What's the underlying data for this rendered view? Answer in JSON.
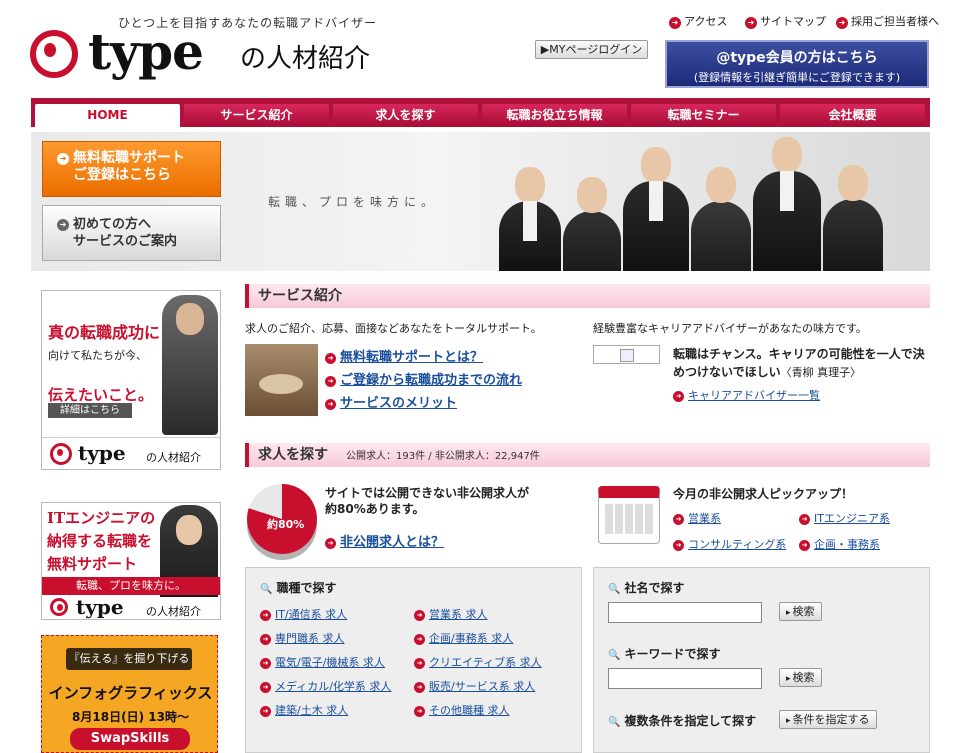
{
  "header": {
    "tagline": "ひとつ上を目指すあなたの転職アドバイザー",
    "logo_type": "type",
    "logo_sub": "の人材紹介",
    "links": [
      "アクセス",
      "サイトマップ",
      "採用ご担当者様へ"
    ],
    "mypage_label": "MYページログイン",
    "member_line1": "@type会員の方はこちら",
    "member_line2": "(登録情報を引継ぎ簡単にご登録できます)"
  },
  "nav": [
    "HOME",
    "サービス紹介",
    "求人を探す",
    "転職お役立ち情報",
    "転職セミナー",
    "会社概要"
  ],
  "hero": {
    "orange_line1": "無料転職サポート",
    "orange_line2": "ご登録はこちら",
    "gray_line1": "初めての方へ",
    "gray_line2": "サービスのご案内",
    "catch": "転職、プロを味方に。"
  },
  "sidebar": {
    "banner1": {
      "t1": "真の転職成功に",
      "t2a": "向けて私たちが今、",
      "t3": "伝えたいこと。",
      "button": "詳細はこちら",
      "logo_type": "type",
      "logo_sub": "の人材紹介"
    },
    "banner2": {
      "l1": "ITエンジニアの",
      "l2": "納得する転職を",
      "l3": "無料サポート",
      "bar": "転職、プロを味方に。",
      "logo_type": "type",
      "logo_sub": "の人材紹介"
    },
    "banner3": {
      "tag": "『伝える』を掘り下げる",
      "big": "インフォグラフィックス",
      "date": "8月18日(日) 13時〜",
      "swap": "SwapSkills"
    }
  },
  "services": {
    "title": "サービス紹介",
    "left_intro": "求人のご紹介、応募、面接などあなたをトータルサポート。",
    "links": [
      "無料転職サポートとは？",
      "ご登録から転職成功までの流れ",
      "サービスのメリット"
    ],
    "right_intro": "経験豊富なキャリアアドバイザーがあなたの味方です。",
    "quote_line1": "転職はチャンス。キャリアの可能性を一人で決",
    "quote_line2": "めつけないでほしい",
    "quote_author": "〈青柳 真理子〉",
    "advisor_link": "キャリアアドバイザー一覧"
  },
  "jobs": {
    "title": "求人を探す",
    "counts": "公開求人：193件 / 非公開求人：22,947件",
    "pie_label": "約80%",
    "private_line1": "サイトでは公開できない非公開求人が",
    "private_line2": "約80%あります。",
    "private_link": "非公開求人とは？",
    "pickup_title": "今月の非公開求人ピックアップ！",
    "pickup_links": [
      "営業系",
      "ITエンジニア系",
      "コンサルティング系",
      "企画・事務系"
    ]
  },
  "occupation": {
    "title": "職種で探す",
    "left": [
      "IT/通信系 求人",
      "専門職系 求人",
      "電気/電子/機械系 求人",
      "メディカル/化学系 求人",
      "建築/土木 求人"
    ],
    "right": [
      "営業系 求人",
      "企画/事務系 求人",
      "クリエイティブ系 求人",
      "販売/サービス系 求人",
      "その他職種 求人"
    ]
  },
  "search": {
    "company_title": "社名で探す",
    "keyword_title": "キーワードで探す",
    "multi_title": "複数条件を指定して探す",
    "search_button": "検索",
    "condition_button": "条件を指定する"
  },
  "colors": {
    "brand_red": "#c8102e",
    "link_blue": "#1a4f9c",
    "orange": "#ea6d00",
    "navy": "#1c2a78"
  }
}
